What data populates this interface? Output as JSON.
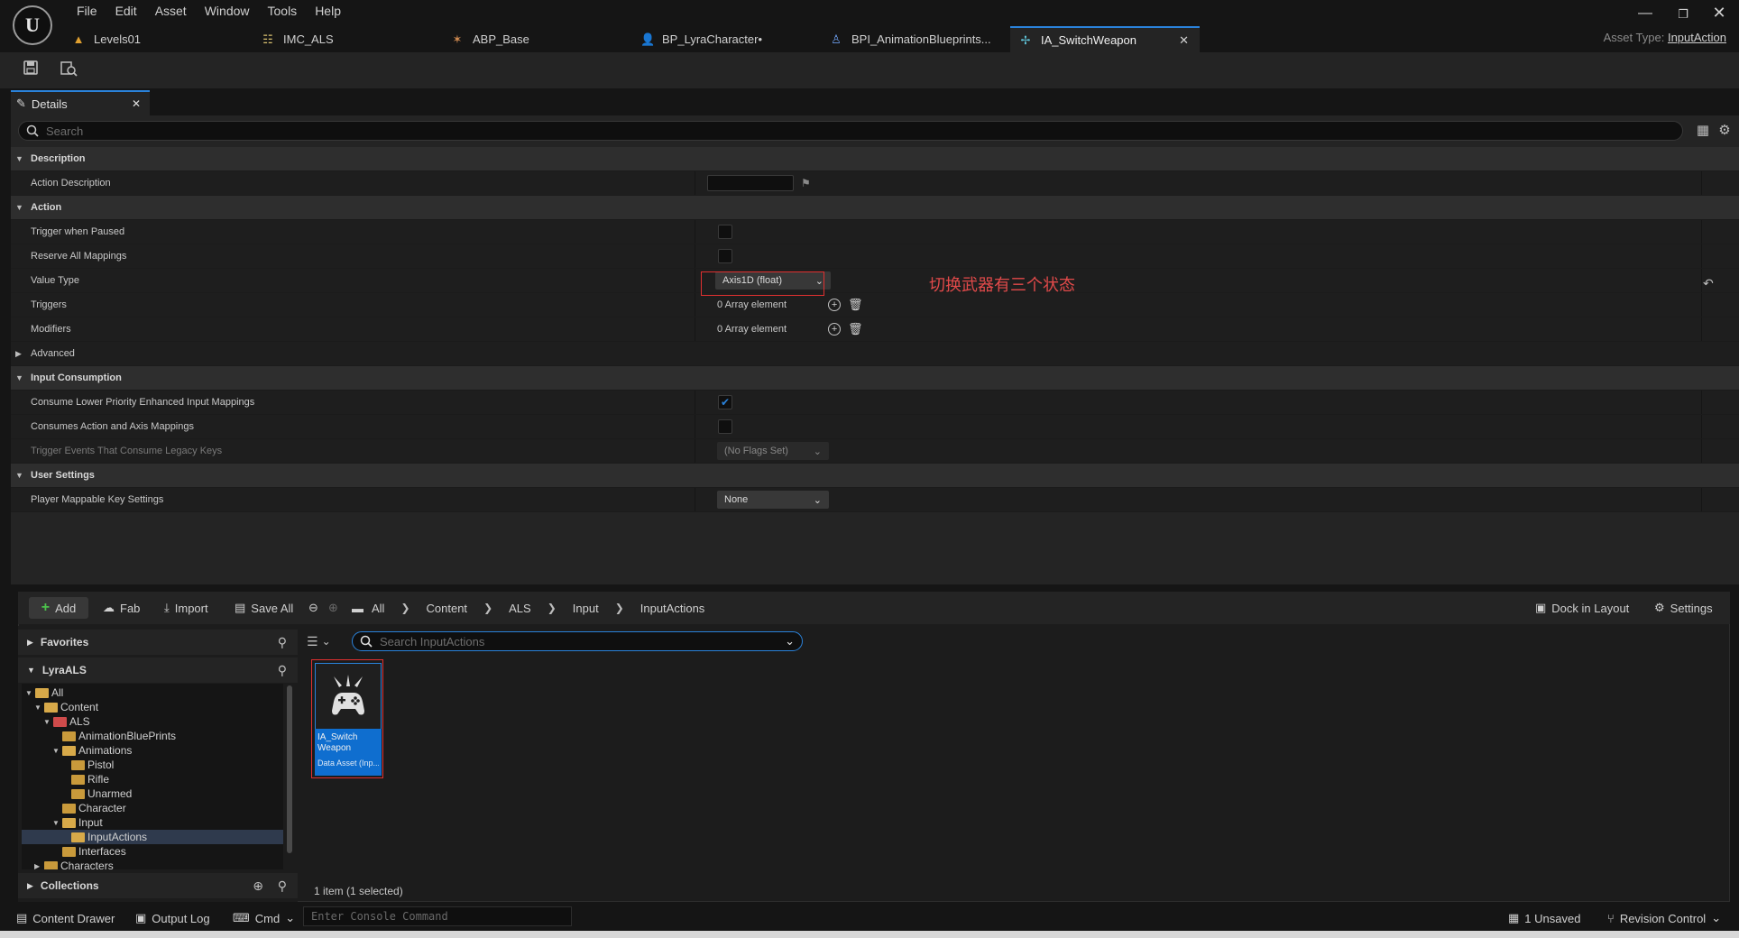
{
  "menu": [
    "File",
    "Edit",
    "Asset",
    "Window",
    "Tools",
    "Help"
  ],
  "tabs": [
    {
      "label": "Levels01",
      "icon": "level-icon"
    },
    {
      "label": "IMC_ALS",
      "icon": "mapping-context-icon"
    },
    {
      "label": "ABP_Base",
      "icon": "anim-blueprint-icon"
    },
    {
      "label": "BP_LyraCharacter•",
      "icon": "character-blueprint-icon"
    },
    {
      "label": "BPI_AnimationBlueprints...",
      "icon": "interface-blueprint-icon"
    },
    {
      "label": "IA_SwitchWeapon",
      "icon": "input-action-icon",
      "active": true
    }
  ],
  "asset_type": {
    "label": "Asset Type:",
    "value": "InputAction"
  },
  "details": {
    "tab_label": "Details",
    "search_placeholder": "Search",
    "sections": {
      "description": "Description",
      "action": "Action",
      "advanced": "Advanced",
      "input_consumption": "Input Consumption",
      "user_settings": "User Settings"
    },
    "props": {
      "action_description": "Action Description",
      "trigger_when_paused": "Trigger when Paused",
      "reserve_all_mappings": "Reserve All Mappings",
      "value_type": "Value Type",
      "value_type_value": "Axis1D (float)",
      "triggers": "Triggers",
      "triggers_value": "0 Array element",
      "modifiers": "Modifiers",
      "modifiers_value": "0 Array element",
      "consume_lower": "Consume Lower Priority Enhanced Input Mappings",
      "consumes_action_axis": "Consumes Action and Axis Mappings",
      "trigger_events_legacy": "Trigger Events That Consume Legacy Keys",
      "trigger_events_value": "(No Flags Set)",
      "player_mappable": "Player Mappable Key Settings",
      "player_mappable_value": "None"
    },
    "checks": {
      "trigger_when_paused": false,
      "reserve_all_mappings": false,
      "consume_lower": true,
      "consumes_action_axis": false
    },
    "annotation": "切换武器有三个状态"
  },
  "content_browser": {
    "add": "Add",
    "fab": "Fab",
    "import": "Import",
    "save_all": "Save All",
    "breadcrumb": [
      "All",
      "Content",
      "ALS",
      "Input",
      "InputActions"
    ],
    "dock_in_layout": "Dock in Layout",
    "settings": "Settings",
    "favorites": "Favorites",
    "project": "LyraALS",
    "collections": "Collections",
    "search_placeholder": "Search InputActions",
    "tree": [
      "All",
      "Content",
      "ALS",
      "AnimationBluePrints",
      "Animations",
      "Pistol",
      "Rifle",
      "Unarmed",
      "Character",
      "Input",
      "InputActions",
      "Interfaces",
      "Characters"
    ],
    "asset": {
      "name_line1": "IA_Switch",
      "name_line2": "Weapon",
      "type": "Data Asset (Inp..."
    },
    "item_count": "1 item (1 selected)"
  },
  "statusbar": {
    "content_drawer": "Content Drawer",
    "output_log": "Output Log",
    "cmd": "Cmd",
    "console_placeholder": "Enter Console Command",
    "unsaved": "1 Unsaved",
    "revision_control": "Revision Control"
  },
  "colors": {
    "accent": "#2a82da",
    "highlight": "#e03030",
    "annotation": "#e24a4a"
  }
}
